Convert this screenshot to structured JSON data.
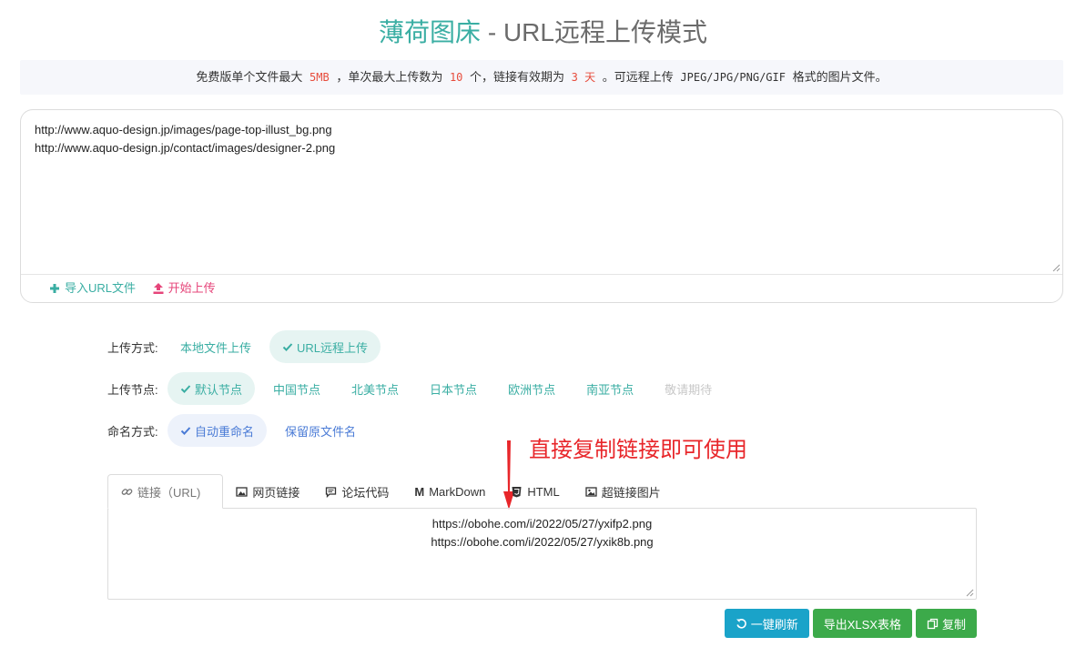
{
  "header": {
    "brand": "薄荷图床",
    "separator": " - ",
    "subtitle": "URL远程上传模式"
  },
  "notice": {
    "t1": "免费版单个文件最大",
    "max_size": "5MB",
    "t2": "，单次最大上传数为",
    "max_count": "10",
    "t3": "个，链接有效期为",
    "expire": "3 天",
    "t4": "。可远程上传",
    "formats": "JPEG/JPG/PNG/GIF",
    "t5": "格式的图片文件。"
  },
  "url_input": {
    "lines": [
      "http://www.aquo-design.jp/images/page-top-illust_bg.png",
      "http://www.aquo-design.jp/contact/images/designer-2.png"
    ],
    "import_label": "导入URL文件",
    "upload_label": "开始上传"
  },
  "upload_method": {
    "label": "上传方式:",
    "options": [
      "本地文件上传",
      "URL远程上传"
    ],
    "selected": 1
  },
  "upload_node": {
    "label": "上传节点:",
    "options": [
      "默认节点",
      "中国节点",
      "北美节点",
      "日本节点",
      "欧洲节点",
      "南亚节点",
      "敬请期待"
    ],
    "selected": 0
  },
  "naming": {
    "label": "命名方式:",
    "options": [
      "自动重命名",
      "保留原文件名"
    ],
    "selected": 0
  },
  "annotation": "直接复制链接即可使用",
  "tabs": [
    {
      "label": "链接（URL)",
      "icon": "link-icon"
    },
    {
      "label": "网页链接",
      "icon": "image-icon"
    },
    {
      "label": "论坛代码",
      "icon": "comment-icon"
    },
    {
      "label": "MarkDown",
      "icon": "markdown-icon"
    },
    {
      "label": "HTML",
      "icon": "html5-icon"
    },
    {
      "label": "超链接图片",
      "icon": "picture-icon"
    }
  ],
  "results": [
    "https://obohe.com/i/2022/05/27/yxifp2.png",
    "https://obohe.com/i/2022/05/27/yxik8b.png"
  ],
  "buttons": {
    "refresh": "一键刷新",
    "export": "导出XLSX表格",
    "copy": "复制"
  },
  "colors": {
    "brand": "#3aaea3",
    "accent_pink": "#e6457a",
    "highlight_red": "#e74c3c",
    "annotation_red": "#e8262a",
    "btn_cyan": "#1aa3c9",
    "btn_green": "#3caa4a"
  }
}
